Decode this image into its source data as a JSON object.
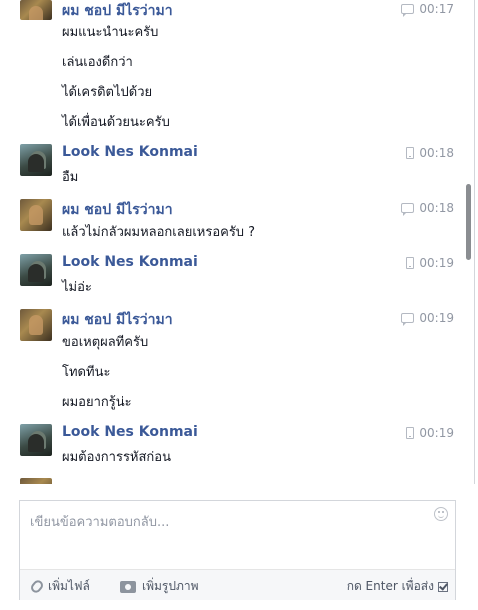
{
  "messages": [
    {
      "sender": "ผม ชอป มีไรว่ามา",
      "time": "00:17",
      "via": "chat",
      "lines": [
        "ผมแนะนำนะครับ",
        "เล่นเองดีกว่า",
        "ได้เครดิตไปด้วย",
        "ได้เพื่อนด้วยนะครับ"
      ]
    },
    {
      "sender": "Look Nes Konmai",
      "time": "00:18",
      "via": "mobile",
      "lines": [
        "อืม"
      ]
    },
    {
      "sender": "ผม ชอป มีไรว่ามา",
      "time": "00:18",
      "via": "chat",
      "lines": [
        "แล้วไม่กลัวผมหลอกเลยเหรอครับ ?"
      ]
    },
    {
      "sender": "Look Nes Konmai",
      "time": "00:19",
      "via": "mobile",
      "lines": [
        "ไม่อ่ะ"
      ]
    },
    {
      "sender": "ผม ชอป มีไรว่ามา",
      "time": "00:19",
      "via": "chat",
      "lines": [
        "ขอเหตุผลทีครับ",
        "โทดทีนะ",
        "ผมอยากรู้น่ะ"
      ]
    },
    {
      "sender": "Look Nes Konmai",
      "time": "00:19",
      "via": "mobile",
      "lines": [
        "ผมต้องการรหัสก่อน"
      ]
    }
  ],
  "composer": {
    "placeholder": "เขียนข้อความตอบกลับ...",
    "attach_label": "เพิ่มไฟล์",
    "photo_label": "เพิ่มรูปภาพ",
    "enter_label": "กด Enter เพื่อส่ง",
    "enter_checked": true
  },
  "icons": {
    "chat": "chat-bubble-icon",
    "mobile": "mobile-phone-icon",
    "attach": "paperclip-icon",
    "photo": "camera-icon",
    "emoji": "smiley-icon"
  },
  "colors": {
    "sender_name": "#3b5998",
    "meta": "#9197a3"
  }
}
